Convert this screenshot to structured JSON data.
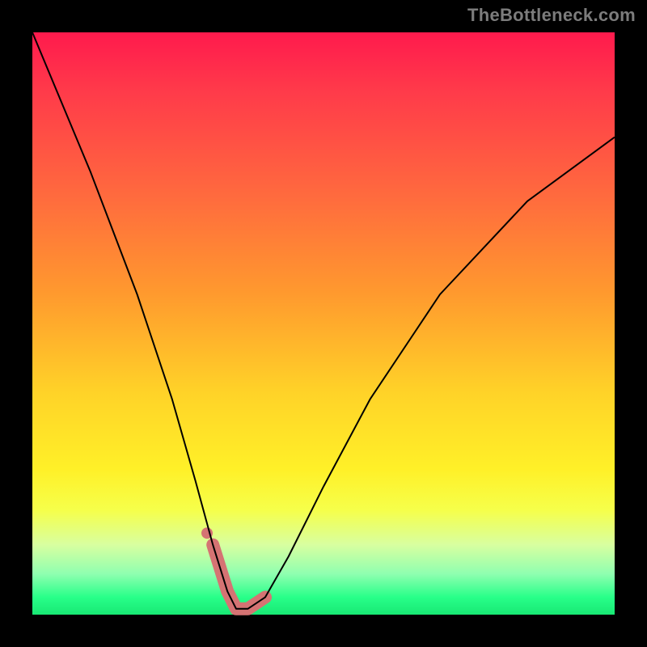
{
  "watermark": "TheBottleneck.com",
  "chart_data": {
    "type": "line",
    "title": "",
    "xlabel": "",
    "ylabel": "",
    "xlim": [
      0,
      100
    ],
    "ylim": [
      0,
      100
    ],
    "grid": false,
    "legend": false,
    "background_gradient": {
      "stops": [
        {
          "pos": 0,
          "color": "#ff1a4d"
        },
        {
          "pos": 28,
          "color": "#ff6a3e"
        },
        {
          "pos": 62,
          "color": "#ffd328"
        },
        {
          "pos": 82,
          "color": "#f6ff4a"
        },
        {
          "pos": 93,
          "color": "#8fffb0"
        },
        {
          "pos": 100,
          "color": "#18e874"
        }
      ]
    },
    "series": [
      {
        "name": "bottleneck-curve",
        "color": "#000000",
        "stroke_width": 2,
        "x": [
          0,
          10,
          18,
          24,
          28,
          31,
          33.5,
          35,
          37,
          40,
          44,
          50,
          58,
          70,
          85,
          100
        ],
        "values": [
          100,
          76,
          55,
          37,
          23,
          12,
          4,
          1,
          1,
          3,
          10,
          22,
          37,
          55,
          71,
          82
        ]
      },
      {
        "name": "highlight-band",
        "color": "#d57373",
        "stroke_width": 16,
        "linecap": "round",
        "x": [
          31,
          33.5,
          35,
          37,
          40
        ],
        "values": [
          12,
          4,
          1,
          1,
          3
        ]
      },
      {
        "name": "highlight-dot",
        "color": "#d57373",
        "type": "scatter",
        "radius": 7,
        "x": [
          30
        ],
        "values": [
          14
        ]
      }
    ]
  }
}
